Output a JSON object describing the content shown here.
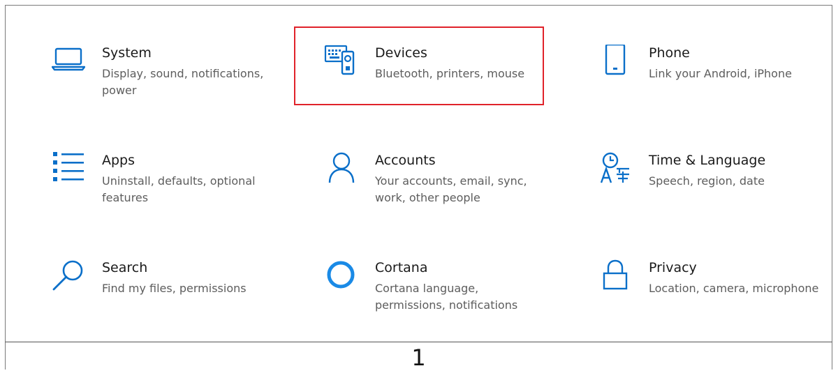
{
  "tiles": [
    {
      "key": "system",
      "title": "System",
      "desc": "Display, sound, notifications, power",
      "icon": "laptop-icon"
    },
    {
      "key": "devices",
      "title": "Devices",
      "desc": "Bluetooth, printers, mouse",
      "icon": "devices-icon"
    },
    {
      "key": "phone",
      "title": "Phone",
      "desc": "Link your Android, iPhone",
      "icon": "phone-icon"
    },
    {
      "key": "apps",
      "title": "Apps",
      "desc": "Uninstall, defaults, optional features",
      "icon": "apps-list-icon"
    },
    {
      "key": "accounts",
      "title": "Accounts",
      "desc": "Your accounts, email, sync, work, other people",
      "icon": "person-icon"
    },
    {
      "key": "time",
      "title": "Time & Language",
      "desc": "Speech, region, date",
      "icon": "time-language-icon"
    },
    {
      "key": "search",
      "title": "Search",
      "desc": "Find my files, permissions",
      "icon": "search-icon"
    },
    {
      "key": "cortana",
      "title": "Cortana",
      "desc": "Cortana language, permissions, notifications",
      "icon": "cortana-circle-icon"
    },
    {
      "key": "privacy",
      "title": "Privacy",
      "desc": "Location, camera, microphone",
      "icon": "lock-icon"
    }
  ],
  "colors": {
    "accent": "#0a6fc9",
    "highlight": "#e0222a"
  },
  "footer": {
    "number": "1"
  }
}
